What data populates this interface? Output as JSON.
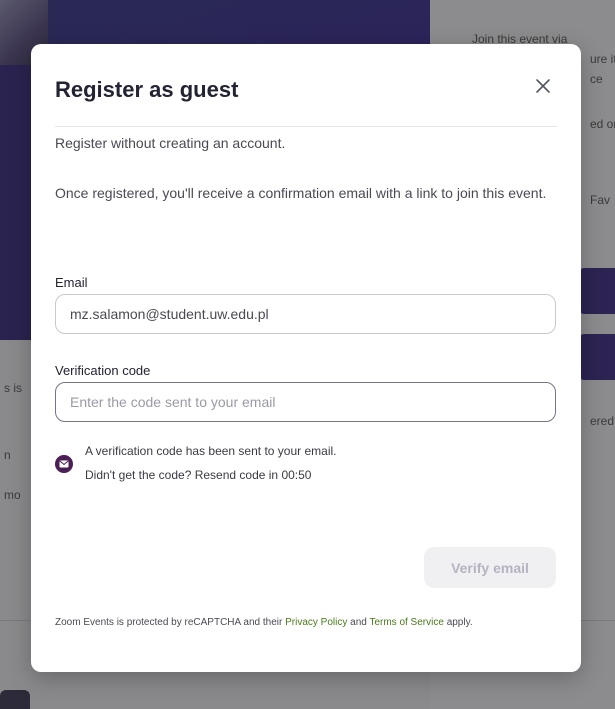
{
  "background": {
    "right_texts": [
      "Join this event via",
      "ure it",
      "ce",
      "ed or",
      "Fav",
      "ered v"
    ],
    "left_texts": [
      "s is",
      "n",
      "mo"
    ]
  },
  "modal": {
    "title": "Register as guest",
    "close_icon": "close-icon",
    "subtitle": "Register without creating an account.",
    "info": "Once registered, you'll receive a confirmation email with a link to join this event.",
    "email": {
      "label": "Email",
      "value": "mz.salamon@student.uw.edu.pl"
    },
    "verification_code": {
      "label": "Verification code",
      "value": "",
      "placeholder": "Enter the code sent to your email"
    },
    "notice": {
      "icon": "mail-icon",
      "line1": "A verification code has been sent to your email.",
      "line2_prefix": "Didn't get the code?",
      "resend_label": "Resend code in 00:50"
    },
    "verify_button": "Verify email",
    "footer": {
      "prefix": "Zoom Events is protected by reCAPTCHA and their",
      "privacy_link": "Privacy Policy",
      "and": "and",
      "terms_link": "Terms of Service",
      "suffix": "apply."
    }
  },
  "colors": {
    "accent": "#4a1f55",
    "link": "#4a7a1a",
    "button_disabled_bg": "#f0f0f3",
    "button_disabled_text": "#b4b4c0"
  }
}
